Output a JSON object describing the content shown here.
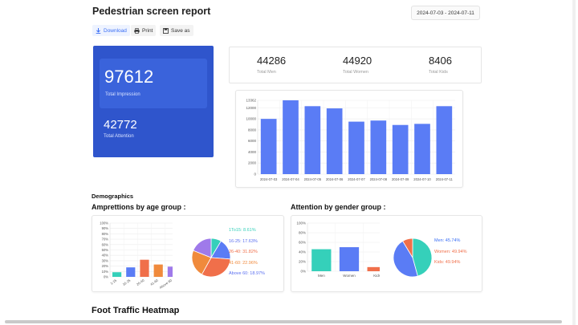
{
  "header": {
    "title": "Pedestrian screen report",
    "date_range": "2024-07-03 - 2024-07-11"
  },
  "toolbar": {
    "download": "Download",
    "print": "Print",
    "save_as": "Save as"
  },
  "impressions": {
    "value": "97612",
    "label": "Total Impression"
  },
  "attention": {
    "value": "42772",
    "label": "Total Attention"
  },
  "stats": [
    {
      "value": "44286",
      "label": "Total Men"
    },
    {
      "value": "44920",
      "label": "Total Women"
    },
    {
      "value": "8406",
      "label": "Total Kids"
    }
  ],
  "demographics": {
    "section_title": "Demographics",
    "age_title": "Amprettions by age group :",
    "gender_title": "Attention by gender group :",
    "age_legend": [
      {
        "label": "1To15: 8.61%",
        "color": "#35d0ba"
      },
      {
        "label": "16-25: 17.63%",
        "color": "#5a6ff0"
      },
      {
        "label": "26-40: 31.82%",
        "color": "#f06f4a"
      },
      {
        "label": "41-60: 22.96%",
        "color": "#f08a3c"
      },
      {
        "label": "Above 60: 18.97%",
        "color": "#5a6ff0"
      }
    ],
    "gender_legend": [
      {
        "label": "Men: 45.74%",
        "color": "#3b6ff5"
      },
      {
        "label": "Women: 49.94%",
        "color": "#f06f4a"
      },
      {
        "label": "Kids: 49.94%",
        "color": "#f06f4a"
      }
    ]
  },
  "heatmap": {
    "title": "Foot Traffic Heatmap"
  },
  "chart_data": [
    {
      "type": "bar",
      "categories": [
        "2024-07-03",
        "2024-07-04",
        "2024-07-05",
        "2024-07-06",
        "2024-07-07",
        "2024-07-08",
        "2024-07-09",
        "2024-07-10",
        "2024-07-11"
      ],
      "values": [
        10000,
        13362,
        12300,
        11900,
        9500,
        9700,
        8900,
        9100,
        12300
      ],
      "yticks": [
        "0",
        "2000",
        "4000",
        "6000",
        "8000",
        "10000",
        "12000",
        "13362"
      ],
      "ylim": [
        0,
        13362
      ],
      "color": "#5a7cf5"
    },
    {
      "type": "bar",
      "categories": [
        "1-15",
        "16-25",
        "26-40",
        "41-60",
        "Above 60"
      ],
      "values": [
        8.61,
        17.63,
        31.82,
        22.96,
        18.97
      ],
      "colors": [
        "#35d0ba",
        "#5a7cf5",
        "#f06f4a",
        "#f08a3c",
        "#9f7aea"
      ],
      "yticks": [
        "0%",
        "10%",
        "20%",
        "30%",
        "40%",
        "50%",
        "60%",
        "70%",
        "80%",
        "90%",
        "100%"
      ],
      "ylim": [
        0,
        100
      ]
    },
    {
      "type": "pie",
      "labels": [
        "1To15",
        "16-25",
        "26-40",
        "41-60",
        "Above 60"
      ],
      "values": [
        8.61,
        17.63,
        31.82,
        22.96,
        18.97
      ],
      "colors": [
        "#35d0ba",
        "#5a7cf5",
        "#f06f4a",
        "#f08a3c",
        "#9f7aea"
      ]
    },
    {
      "type": "bar",
      "categories": [
        "Men",
        "Women",
        "Kids"
      ],
      "values": [
        45.74,
        49.94,
        8.6
      ],
      "colors": [
        "#35d0ba",
        "#5a7cf5",
        "#f06f4a"
      ],
      "yticks": [
        "0%",
        "20%",
        "40%",
        "60%",
        "80%",
        "100%"
      ],
      "ylim": [
        0,
        100
      ]
    },
    {
      "type": "pie",
      "labels": [
        "Men",
        "Women",
        "Kids"
      ],
      "values": [
        45.74,
        45.66,
        8.6
      ],
      "colors": [
        "#35d0ba",
        "#5a7cf5",
        "#f06f4a"
      ]
    }
  ]
}
